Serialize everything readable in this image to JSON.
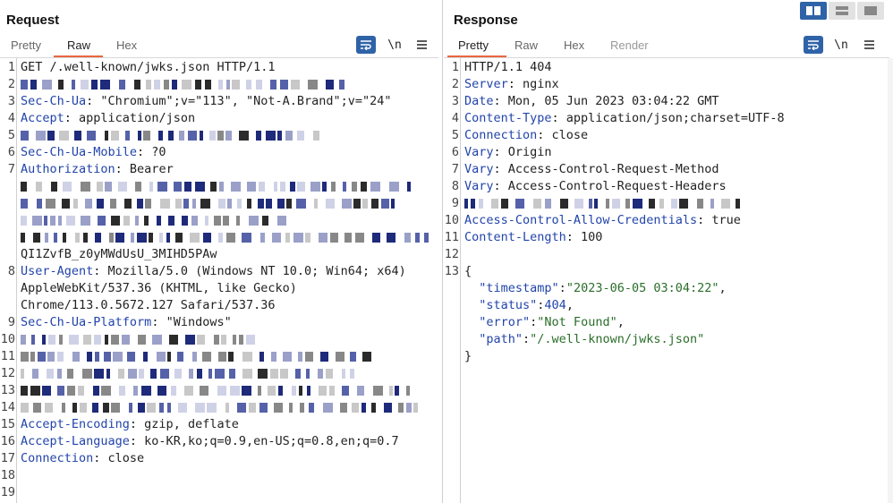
{
  "request": {
    "title": "Request",
    "tabs": [
      "Pretty",
      "Raw",
      "Hex"
    ],
    "active_tab": "Raw",
    "newline_label": "\\n",
    "lines": [
      {
        "num": "1",
        "segments": [
          {
            "t": "GET /.well-known/jwks.json HTTP/1.1",
            "c": ""
          }
        ]
      },
      {
        "num": "2",
        "segments": [],
        "redacted": true
      },
      {
        "num": "3",
        "segments": [
          {
            "t": "Sec-Ch-Ua",
            "c": "k"
          },
          {
            "t": ": \"Chromium\";v=\"113\", \"Not-A.Brand\";v=\"24\"",
            "c": ""
          }
        ]
      },
      {
        "num": "4",
        "segments": [
          {
            "t": "Accept",
            "c": "k"
          },
          {
            "t": ": application/json",
            "c": ""
          }
        ]
      },
      {
        "num": "5",
        "segments": [],
        "redacted": true
      },
      {
        "num": "6",
        "segments": [
          {
            "t": "Sec-Ch-Ua-Mobile",
            "c": "k"
          },
          {
            "t": ": ?0",
            "c": ""
          }
        ]
      },
      {
        "num": "7",
        "segments": [
          {
            "t": "Authorization",
            "c": "k"
          },
          {
            "t": ": Bearer",
            "c": ""
          }
        ]
      },
      {
        "num": "",
        "segments": [],
        "redacted": true
      },
      {
        "num": "",
        "segments": [],
        "redacted": true
      },
      {
        "num": "",
        "segments": [],
        "redacted": true
      },
      {
        "num": "",
        "segments": [],
        "redacted": true
      },
      {
        "num": "",
        "segments": [
          {
            "t": "QI1ZvfB_z0yMWdUsU_3MIHD5PAw",
            "c": ""
          }
        ]
      },
      {
        "num": "8",
        "segments": [
          {
            "t": "User-Agent",
            "c": "k"
          },
          {
            "t": ": Mozilla/5.0 (Windows NT 10.0; Win64; x64)",
            "c": ""
          }
        ]
      },
      {
        "num": "",
        "segments": [
          {
            "t": "AppleWebKit/537.36 (KHTML, like Gecko)",
            "c": ""
          }
        ]
      },
      {
        "num": "",
        "segments": [
          {
            "t": "Chrome/113.0.5672.127 Safari/537.36",
            "c": ""
          }
        ]
      },
      {
        "num": "9",
        "segments": [
          {
            "t": "Sec-Ch-Ua-Platform",
            "c": "k"
          },
          {
            "t": ": \"Windows\"",
            "c": ""
          }
        ]
      },
      {
        "num": "10",
        "segments": [],
        "redacted": true
      },
      {
        "num": "11",
        "segments": [],
        "redacted": true
      },
      {
        "num": "12",
        "segments": [],
        "redacted": true
      },
      {
        "num": "13",
        "segments": [],
        "redacted": true
      },
      {
        "num": "14",
        "segments": [],
        "redacted": true
      },
      {
        "num": "15",
        "segments": [
          {
            "t": "Accept-Encoding",
            "c": "k"
          },
          {
            "t": ": gzip, deflate",
            "c": ""
          }
        ]
      },
      {
        "num": "16",
        "segments": [
          {
            "t": "Accept-Language",
            "c": "k"
          },
          {
            "t": ": ko-KR,ko;q=0.9,en-US;q=0.8,en;q=0.7",
            "c": ""
          }
        ]
      },
      {
        "num": "17",
        "segments": [
          {
            "t": "Connection",
            "c": "k"
          },
          {
            "t": ": close",
            "c": ""
          }
        ]
      },
      {
        "num": "18",
        "segments": []
      },
      {
        "num": "19",
        "segments": []
      }
    ]
  },
  "response": {
    "title": "Response",
    "tabs": [
      "Pretty",
      "Raw",
      "Hex",
      "Render"
    ],
    "active_tab": "Pretty",
    "newline_label": "\\n",
    "lines": [
      {
        "num": "1",
        "segments": [
          {
            "t": "HTTP/1.1 404",
            "c": ""
          }
        ]
      },
      {
        "num": "2",
        "segments": [
          {
            "t": "Server",
            "c": "k"
          },
          {
            "t": ": nginx",
            "c": ""
          }
        ]
      },
      {
        "num": "3",
        "segments": [
          {
            "t": "Date",
            "c": "k"
          },
          {
            "t": ": Mon, 05 Jun 2023 03:04:22 GMT",
            "c": ""
          }
        ]
      },
      {
        "num": "4",
        "segments": [
          {
            "t": "Content-Type",
            "c": "k"
          },
          {
            "t": ": application/json;charset=UTF-8",
            "c": ""
          }
        ]
      },
      {
        "num": "5",
        "segments": [
          {
            "t": "Connection",
            "c": "k"
          },
          {
            "t": ": close",
            "c": ""
          }
        ]
      },
      {
        "num": "6",
        "segments": [
          {
            "t": "Vary",
            "c": "k"
          },
          {
            "t": ": Origin",
            "c": ""
          }
        ]
      },
      {
        "num": "7",
        "segments": [
          {
            "t": "Vary",
            "c": "k"
          },
          {
            "t": ": Access-Control-Request-Method",
            "c": ""
          }
        ]
      },
      {
        "num": "8",
        "segments": [
          {
            "t": "Vary",
            "c": "k"
          },
          {
            "t": ": Access-Control-Request-Headers",
            "c": ""
          }
        ]
      },
      {
        "num": "9",
        "segments": [],
        "redacted": true
      },
      {
        "num": "10",
        "segments": [
          {
            "t": "Access-Control-Allow-Credentials",
            "c": "k"
          },
          {
            "t": ": true",
            "c": ""
          }
        ]
      },
      {
        "num": "11",
        "segments": [
          {
            "t": "Content-Length",
            "c": "k"
          },
          {
            "t": ": 100",
            "c": ""
          }
        ]
      },
      {
        "num": "12",
        "segments": []
      },
      {
        "num": "13",
        "segments": [
          {
            "t": "{",
            "c": ""
          }
        ]
      },
      {
        "num": "",
        "segments": [
          {
            "t": "  \"timestamp\"",
            "c": "n"
          },
          {
            "t": ":",
            "c": ""
          },
          {
            "t": "\"2023-06-05 03:04:22\"",
            "c": "s"
          },
          {
            "t": ",",
            "c": ""
          }
        ]
      },
      {
        "num": "",
        "segments": [
          {
            "t": "  \"status\"",
            "c": "n"
          },
          {
            "t": ":",
            "c": ""
          },
          {
            "t": "404",
            "c": "n"
          },
          {
            "t": ",",
            "c": ""
          }
        ]
      },
      {
        "num": "",
        "segments": [
          {
            "t": "  \"error\"",
            "c": "n"
          },
          {
            "t": ":",
            "c": ""
          },
          {
            "t": "\"Not Found\"",
            "c": "s"
          },
          {
            "t": ",",
            "c": ""
          }
        ]
      },
      {
        "num": "",
        "segments": [
          {
            "t": "  \"path\"",
            "c": "n"
          },
          {
            "t": ":",
            "c": ""
          },
          {
            "t": "\"/.well-known/jwks.json\"",
            "c": "s"
          }
        ]
      },
      {
        "num": "",
        "segments": [
          {
            "t": "}",
            "c": ""
          }
        ]
      }
    ]
  },
  "colors": {
    "accent_blue": "#2f63a8",
    "tab_underline": "#e8683f",
    "header_key": "#2244aa",
    "json_string": "#2a6e2a"
  },
  "icons": {
    "wrap": "word-wrap-icon",
    "newline": "newline-icon",
    "menu": "hamburger-menu-icon",
    "layout_split": "split-horizontal-icon",
    "layout_vertical": "split-vertical-icon",
    "layout_single": "single-pane-icon"
  }
}
